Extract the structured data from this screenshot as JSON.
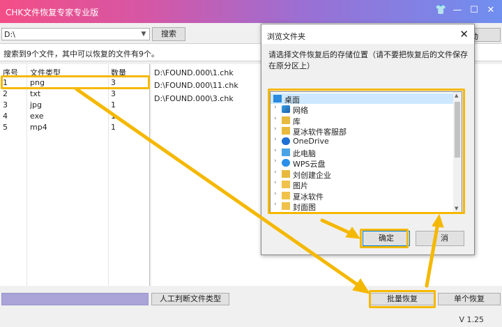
{
  "window": {
    "title": "CHK文件恢复专家专业版",
    "controls": [
      "shirt-icon",
      "minimize",
      "maximize",
      "close"
    ]
  },
  "toolbar": {
    "drive": "D:\\",
    "search_label": "搜索",
    "partial_label": "动"
  },
  "status": "搜索到9个文件，其中可以恢复的文件有9个。",
  "table": {
    "headers": [
      "序号",
      "文件类型",
      "数量"
    ],
    "rows": [
      [
        "1",
        "png",
        "3"
      ],
      [
        "2",
        "txt",
        "3"
      ],
      [
        "3",
        "jpg",
        "1"
      ],
      [
        "4",
        "exe",
        "1"
      ],
      [
        "5",
        "mp4",
        "1"
      ]
    ]
  },
  "files": [
    "D:\\FOUND.000\\1.chk",
    "D:\\FOUND.000\\11.chk",
    "D:\\FOUND.000\\3.chk"
  ],
  "bottom": {
    "judge_label": "人工判断文件类型",
    "batch_label": "批量恢复",
    "single_label": "单个恢复",
    "version": "V 1.25"
  },
  "dialog": {
    "title": "浏览文件夹",
    "message": "请选择文件恢复后的存储位置（请不要把恢复后的文件保存在原分区上）",
    "tree": [
      {
        "label": "桌面",
        "icon": "desktop-icon",
        "top": true,
        "selected": true
      },
      {
        "label": "网络",
        "icon": "network-icon"
      },
      {
        "label": "库",
        "icon": "library-icon"
      },
      {
        "label": "夏冰软件客服部",
        "icon": "user-folder-icon"
      },
      {
        "label": "OneDrive",
        "icon": "onedrive-icon"
      },
      {
        "label": "此电脑",
        "icon": "computer-icon"
      },
      {
        "label": "WPS云盘",
        "icon": "wps-cloud-icon"
      },
      {
        "label": "刘创建企业",
        "icon": "user-folder-icon"
      },
      {
        "label": "图片",
        "icon": "folder-icon"
      },
      {
        "label": "夏冰软件",
        "icon": "folder-icon"
      },
      {
        "label": "封面图",
        "icon": "folder-icon"
      }
    ],
    "ok_label": "确定",
    "cancel_label": "取消",
    "cancel_visible": "消"
  },
  "colors": {
    "annotation": "#f5b800",
    "title_gradient_start": "#f34e86",
    "title_gradient_end": "#6f8ff0"
  }
}
